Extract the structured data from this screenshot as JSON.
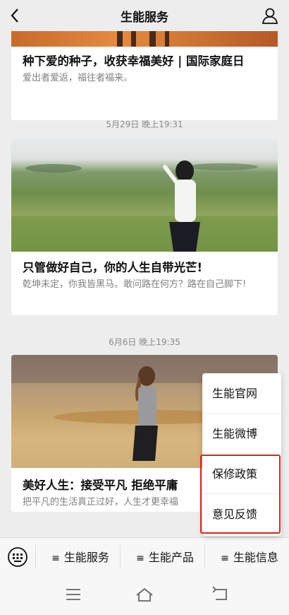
{
  "header": {
    "title": "生能服务",
    "back_icon": "chevron-left-icon",
    "profile_icon": "person-icon"
  },
  "feed": {
    "articles": [
      {
        "title": "种下爱的种子，收获幸福美好 | 国际家庭日",
        "summary": "爱出者爱返，福往者福来。"
      },
      {
        "timestamp": "5月29日 晚上19:31",
        "title": "只管做好自己，你的人生自带光芒!",
        "summary": "乾坤未定，你我皆黑马。敢问路在何方？路在自己脚下!"
      },
      {
        "timestamp": "6月6日 晚上19:35",
        "title": "美好人生：接受平凡  拒绝平庸",
        "summary": "把平凡的生活真正过好，人生才更幸福"
      }
    ]
  },
  "popup_menu": {
    "items": [
      "生能官网",
      "生能微博",
      "保修政策",
      "意见反馈"
    ],
    "highlight_color": "#e02020"
  },
  "menu_bar": {
    "keyboard_icon": "keyboard-icon",
    "items": [
      "生能服务",
      "生能产品",
      "生能信息"
    ],
    "item_glyph": "≡"
  },
  "nav_bar": {
    "icons": [
      "menu-icon",
      "home-icon",
      "back-icon"
    ]
  }
}
